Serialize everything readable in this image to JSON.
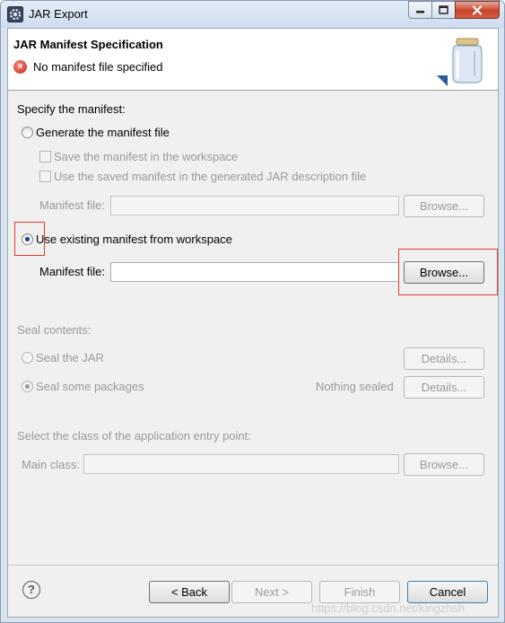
{
  "window": {
    "title": "JAR Export"
  },
  "header": {
    "title": "JAR Manifest Specification",
    "message": "No manifest file specified"
  },
  "specify": {
    "label": "Specify the manifest:",
    "generate_option": "Generate the manifest file",
    "save_in_workspace": "Save the manifest in the workspace",
    "use_saved_in_description": "Use the saved manifest in the generated JAR description file",
    "manifest_file_label": "Manifest file:",
    "browse_label": "Browse...",
    "use_existing_option": "Use existing manifest from workspace",
    "existing_manifest_label": "Manifest file:",
    "existing_manifest_value": "",
    "existing_browse_label": "Browse..."
  },
  "seal": {
    "label": "Seal contents:",
    "seal_jar": "Seal the JAR",
    "seal_jar_details": "Details...",
    "seal_some": "Seal some packages",
    "nothing_sealed": "Nothing sealed",
    "seal_some_details": "Details..."
  },
  "entry_point": {
    "label": "Select the class of the application entry point:",
    "main_class_label": "Main class:",
    "browse_label": "Browse..."
  },
  "footer": {
    "back": "< Back",
    "next": "Next >",
    "finish": "Finish",
    "cancel": "Cancel"
  },
  "watermark": "https://blog.csdn.net/kingzhsh",
  "colors": {
    "highlight": "#e53935",
    "error": "#c8281a",
    "disabled_text": "#9a9a9a"
  },
  "icons": {
    "app": "eclipse-gear-icon",
    "error": "error-icon",
    "banner": "jar-icon",
    "help": "help-icon"
  }
}
